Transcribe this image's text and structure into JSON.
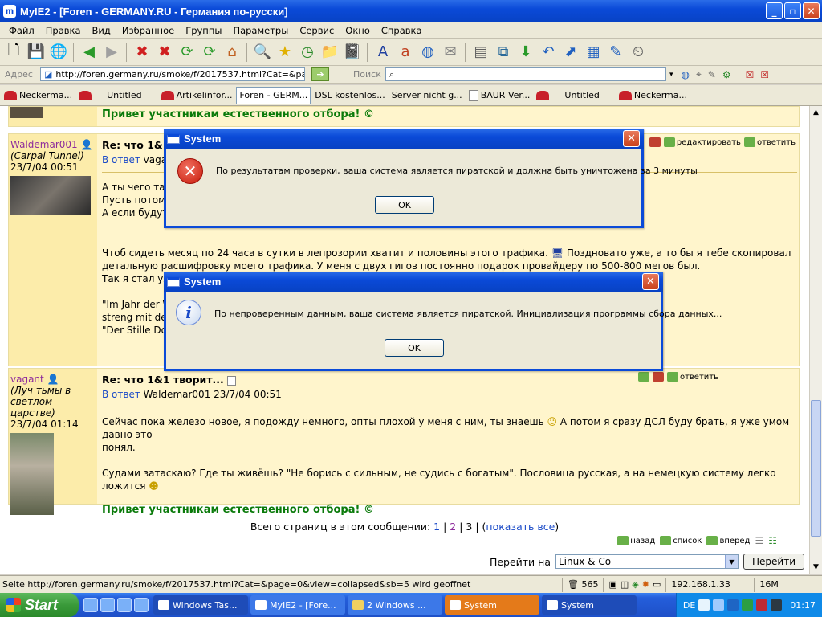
{
  "window": {
    "title": "MyIE2 - [Foren - GERMANY.RU - Германия по-русски]"
  },
  "menu": [
    "Файл",
    "Правка",
    "Вид",
    "Избранное",
    "Группы",
    "Параметры",
    "Сервис",
    "Окно",
    "Справка"
  ],
  "address": {
    "label": "Адрес",
    "url": "http://foren.germany.ru/smoke/f/2017537.html?Cat=&page=(",
    "search_label": "Поиск"
  },
  "tabs": [
    {
      "label": "Neckerma...",
      "icon": "brand-icon"
    },
    {
      "label": "Untitled",
      "icon": "brand-icon"
    },
    {
      "label": "Artikelinfor...",
      "icon": "brand-icon"
    },
    {
      "label": "Foren - GERM...",
      "icon": "none",
      "active": true
    },
    {
      "label": "DSL kostenlos...",
      "icon": "none"
    },
    {
      "label": "Server nicht g...",
      "icon": "none"
    },
    {
      "label": "BAUR Ver...",
      "icon": "doc-icon"
    },
    {
      "label": "Untitled",
      "icon": "brand-icon"
    },
    {
      "label": "Neckerma...",
      "icon": "brand-icon"
    }
  ],
  "top_signature": "Привет участникам естественного отбора! ©",
  "post1": {
    "author": "Waldemar001",
    "author_title": "(Carpal Tunnel)",
    "date": "23/7/04 00:51",
    "subject": "Re: что 1&1",
    "reply_prefix": "В ответ",
    "reply_to": "vaga",
    "lines": [
      "А ты чего так",
      "Пусть потом п",
      "А если будут"
    ],
    "para1": "Чтоб сидеть месяц по 24 часа в сутки в лепрозории хватит и половины этого трафика.",
    "para1b": "Поздновато уже, а то бы я тебе скопировал",
    "para2": "детальную расшифровку моего трафика. У меня с двух гигов постоянно подарок провайдеру по 500-800 мегов был.",
    "para3": "Так я стал уж",
    "quote1": "\"Im Jahr der W",
    "quote2": "streng mit de",
    "quote3": "\"Der Stille Do",
    "actions": {
      "edit": "редактировать",
      "reply": "ответить"
    }
  },
  "post2": {
    "author": "vagant",
    "author_title": "(Луч тьмы в светлом царстве)",
    "date": "23/7/04 01:14",
    "subject": "Re: что 1&1 творит...",
    "reply_prefix": "В ответ",
    "reply_to": "Waldemar001 23/7/04 00:51",
    "para1": "Сейчас пока железо новое, я подожду немного, опты плохой у меня с ним, ты знаешь",
    "para1b": "А потом я сразу ДСЛ буду брать, я уже умом давно это",
    "para1c": "понял.",
    "para2": "Судами затаскаю? Где ты живёшь? \"Не борись с сильным, не судись с богатым\". Пословица русская, а на немецкую систему легко ложится",
    "signature": "Привет участникам естественного отбора! ©",
    "actions": {
      "reply": "ответить"
    }
  },
  "pagination": {
    "label": "Всего страниц в этом сообщении:",
    "pages": [
      "1",
      "2",
      "3"
    ],
    "show_all": "показать все"
  },
  "navlinks": {
    "back": "назад",
    "list": "список",
    "forward": "вперед"
  },
  "jump": {
    "label": "Перейти на",
    "selected": "Linux & Co",
    "button": "Перейти"
  },
  "status": {
    "text": "Seite http://foren.germany.ru/smoke/f/2017537.html?Cat=&page=0&view=collapsed&sb=5 wird geoffnet",
    "count": "565",
    "ip": "192.168.1.33",
    "mem": "16M"
  },
  "dialog1": {
    "title": "System",
    "message": "По результатам проверки, ваша система является пиратской и должна быть уничтожена за 3 минуты",
    "ok": "OK",
    "icon": "error-icon"
  },
  "dialog2": {
    "title": "System",
    "message": "По непроверенным данным, ваша система является пиратской. Инициализация программы сбора данных...",
    "ok": "OK",
    "icon": "info-icon"
  },
  "taskbar": {
    "start": "Start",
    "tasks": [
      "Windows Tas...",
      "MyIE2 - [Fore...",
      "2 Windows ...",
      "System",
      "System"
    ],
    "lang": "DE",
    "clock": "01:17"
  }
}
